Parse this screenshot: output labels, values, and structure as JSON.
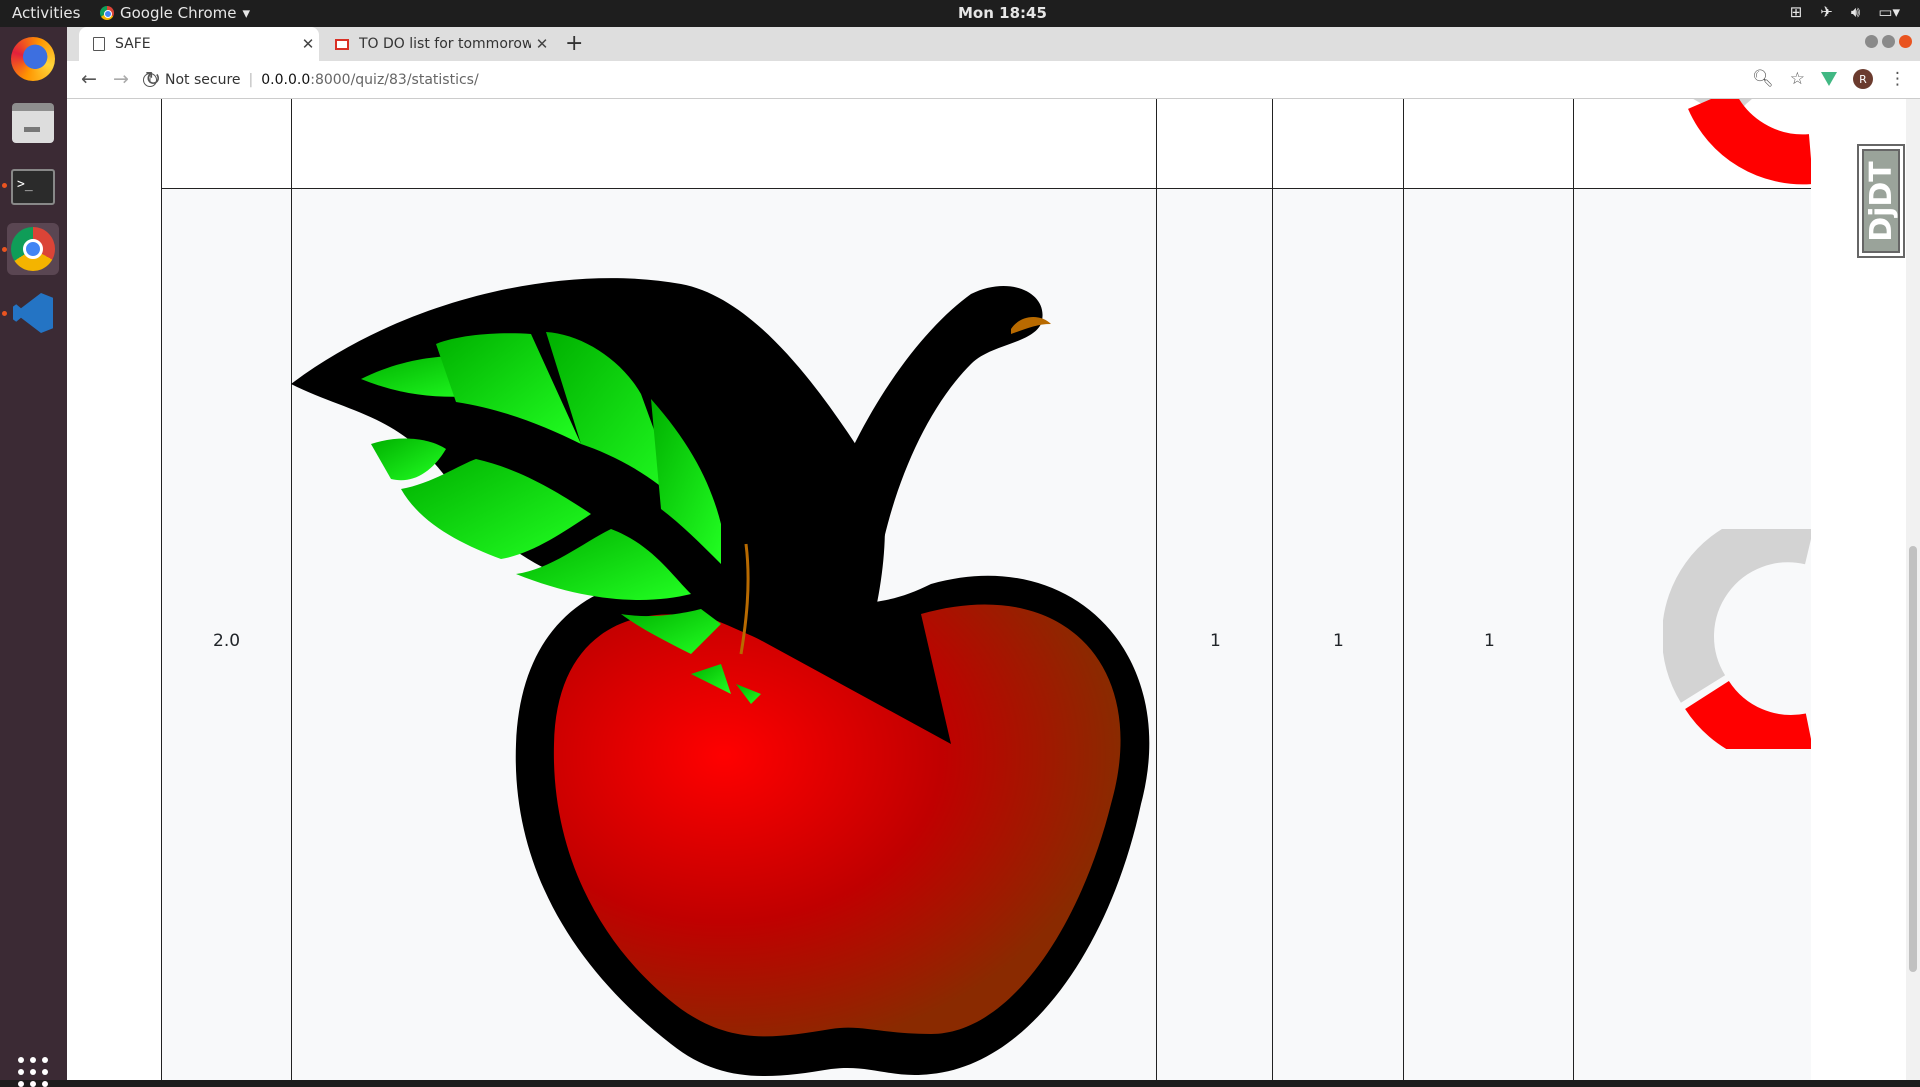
{
  "topbar": {
    "activities": "Activities",
    "app_name": "Google Chrome",
    "clock": "Mon 18:45"
  },
  "dock": {
    "items": [
      "firefox-icon",
      "files-icon",
      "terminal-icon",
      "chrome-icon",
      "vscode-icon"
    ]
  },
  "tabs": [
    {
      "label": "SAFE"
    },
    {
      "label": "TO DO list for tommorow"
    }
  ],
  "omnibox": {
    "security": "Not secure",
    "host": "0.0.0.0",
    "path": ":8000/quiz/83/statistics/"
  },
  "avatar_initial": "R",
  "table": {
    "row": {
      "number": "2.0",
      "col3": "1",
      "col4": "1",
      "col5": "1"
    }
  },
  "debug_toolbar": {
    "label": "DjDT"
  },
  "colors": {
    "donut_red": "#ff0000",
    "donut_grey": "#d3d3d3",
    "apple_red": "#e00000",
    "leaf_green": "#00e000"
  }
}
